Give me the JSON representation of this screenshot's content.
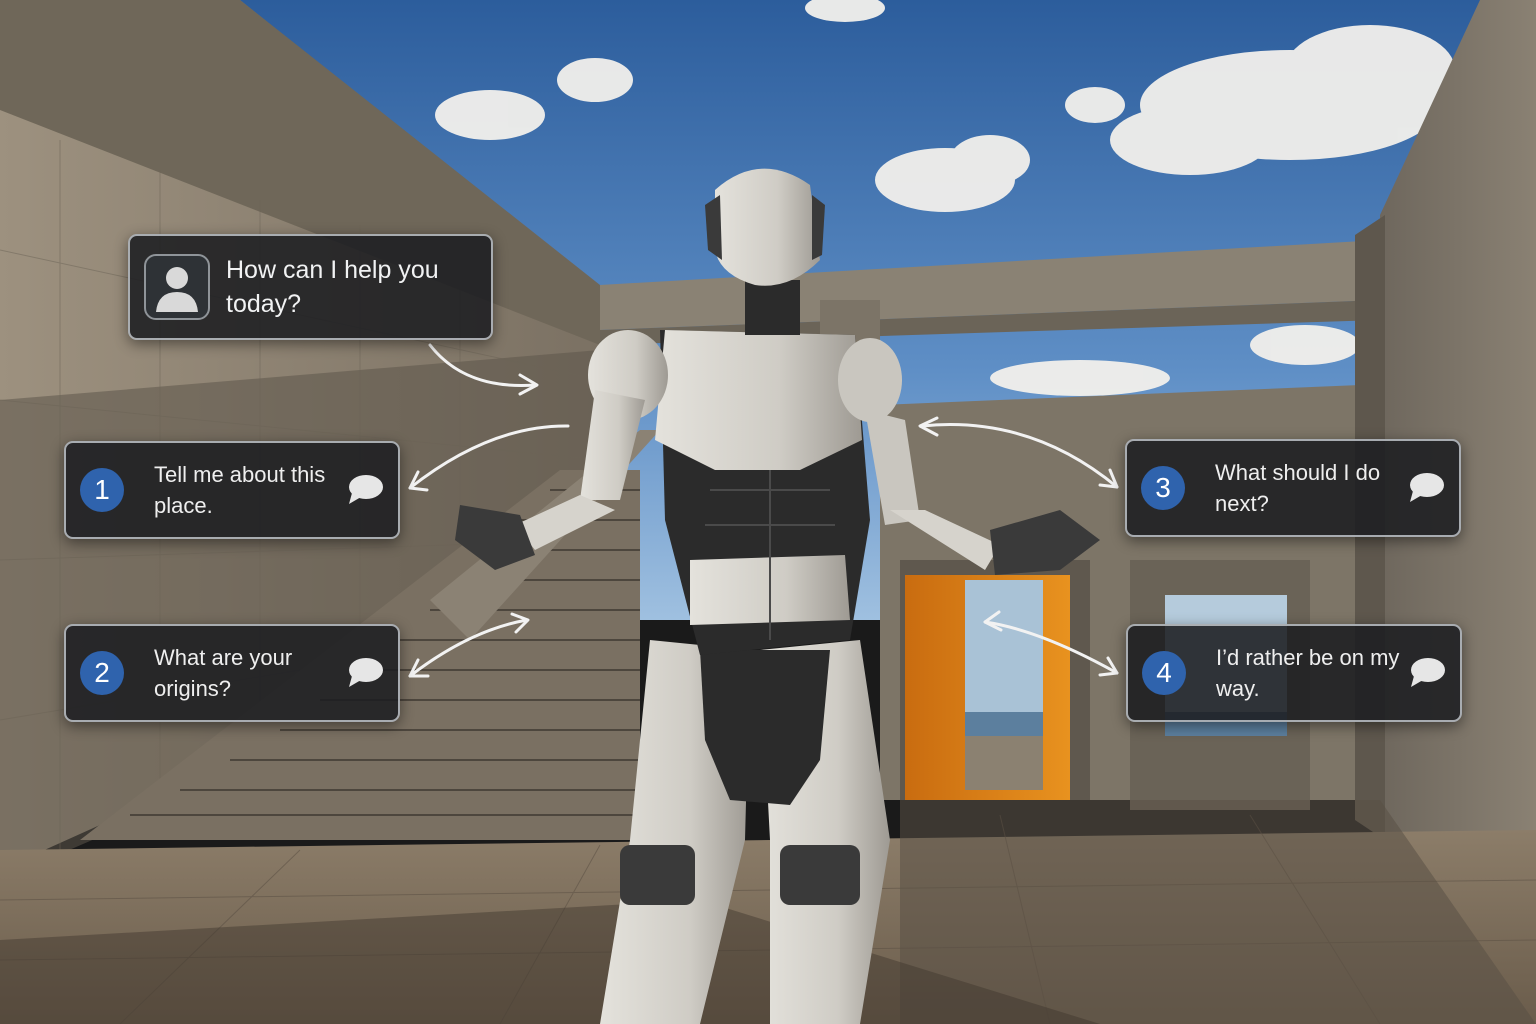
{
  "npc": {
    "avatar_icon": "user-silhouette-icon",
    "line": "How can I help you today?"
  },
  "choices": [
    {
      "number": "1",
      "text": "Tell me about this place.",
      "icon": "speech-bubble-icon"
    },
    {
      "number": "2",
      "text": "What are your origins?",
      "icon": "speech-bubble-icon"
    },
    {
      "number": "3",
      "text": "What should I do next?",
      "icon": "speech-bubble-icon"
    },
    {
      "number": "4",
      "text": "I’d rather be on my way.",
      "icon": "speech-bubble-icon"
    }
  ],
  "colors": {
    "number_badge": "#2f63ad",
    "panel_background": "#1c1e21",
    "panel_border": "#cdd2d7",
    "doorway_accent": "#e0861c",
    "sky": "#3f72b0"
  }
}
